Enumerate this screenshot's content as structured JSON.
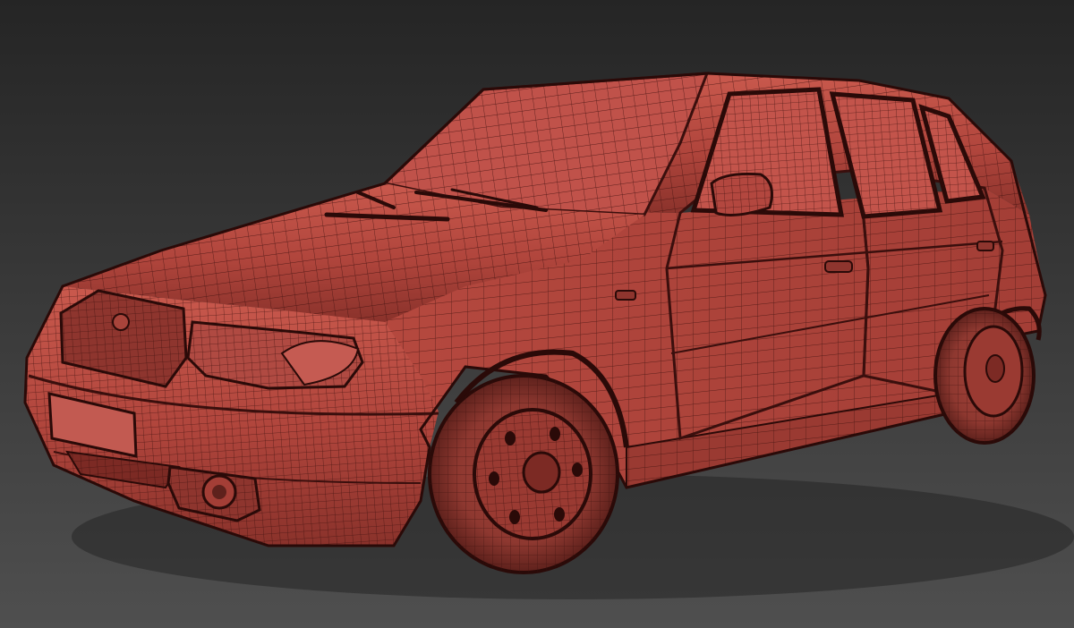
{
  "scene": {
    "subject": "car-wireframe-render",
    "colors": {
      "background_top": "#2a2a2a",
      "background_bottom": "#4e4e4e",
      "body": "#b3473f",
      "body_light": "#c7574c",
      "body_shadow": "#6e2520",
      "wire": "#3a0f0d",
      "glass": "#b84a40",
      "tire": "#7a2e29"
    }
  }
}
